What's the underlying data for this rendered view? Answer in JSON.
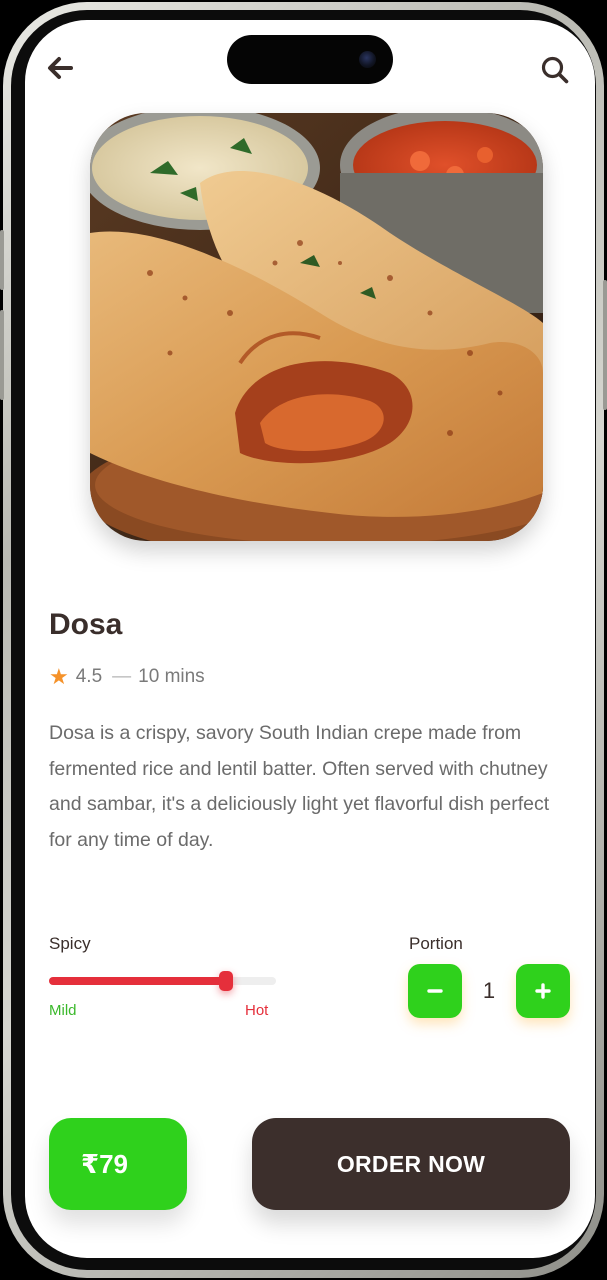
{
  "header": {
    "back_icon": "arrow-left-icon",
    "search_icon": "search-icon"
  },
  "dish": {
    "image_icon": "dosa-photo",
    "name": "Dosa",
    "rating": "4.5",
    "rating_icon": "star-icon",
    "separator": "—",
    "time": "10 mins",
    "description": "Dosa is a crispy, savory South Indian crepe made from fermented rice and lentil batter. Often served with chutney and sambar, it's a deliciously light yet flavorful dish perfect for any time of day."
  },
  "spicy": {
    "label": "Spicy",
    "min_label": "Mild",
    "max_label": "Hot",
    "level": 0.78
  },
  "portion": {
    "label": "Portion",
    "value": "1",
    "decrement_icon": "minus-icon",
    "increment_icon": "plus-icon"
  },
  "footer": {
    "price": "₹79",
    "order_label": "ORDER NOW"
  },
  "colors": {
    "accent_green": "#2fd11c",
    "spicy_red": "#e52f3b",
    "dark_brown": "#3c2f2c",
    "star_orange": "#f5922a"
  }
}
